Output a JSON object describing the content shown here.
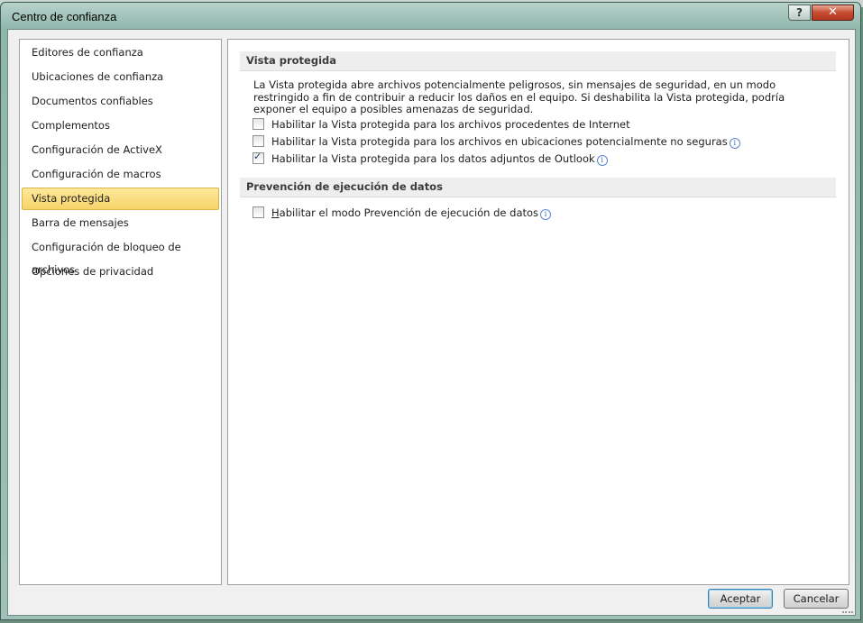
{
  "window": {
    "title": "Centro de confianza",
    "help_label": "?",
    "close_label": "✕"
  },
  "sidebar": {
    "items": [
      {
        "label": "Editores de confianza"
      },
      {
        "label": "Ubicaciones de confianza"
      },
      {
        "label": "Documentos confiables"
      },
      {
        "label": "Complementos"
      },
      {
        "label": "Configuración de ActiveX"
      },
      {
        "label": "Configuración de macros"
      },
      {
        "label": "Vista protegida",
        "selected": true
      },
      {
        "label": "Barra de mensajes"
      },
      {
        "label": "Configuración de bloqueo de archivos"
      },
      {
        "label": "Opciones de privacidad"
      }
    ]
  },
  "protected_view": {
    "header": "Vista protegida",
    "description": "La Vista protegida abre archivos potencialmente peligrosos, sin mensajes de seguridad, en un modo restringido a fin de contribuir a reducir los daños en el equipo. Si deshabilita la Vista protegida, podría exponer el equipo a posibles amenazas de seguridad.",
    "options": [
      {
        "label": "Habilitar la Vista protegida para los archivos procedentes de Internet",
        "checked": false,
        "info": false
      },
      {
        "label": "Habilitar la Vista protegida para los archivos en ubicaciones potencialmente no seguras",
        "checked": false,
        "info": true
      },
      {
        "label": "Habilitar la Vista protegida para los datos adjuntos de Outlook",
        "checked": true,
        "info": true
      }
    ]
  },
  "dep": {
    "header": "Prevención de ejecución de datos",
    "option": {
      "label_accel": "H",
      "label_rest": "abilitar el modo Prevención de ejecución de datos",
      "checked": false,
      "info": true
    }
  },
  "footer": {
    "ok_label": "Aceptar",
    "cancel_label": "Cancelar"
  },
  "colors": {
    "selected_item": "#f8d46a",
    "close_button": "#c74b30"
  }
}
